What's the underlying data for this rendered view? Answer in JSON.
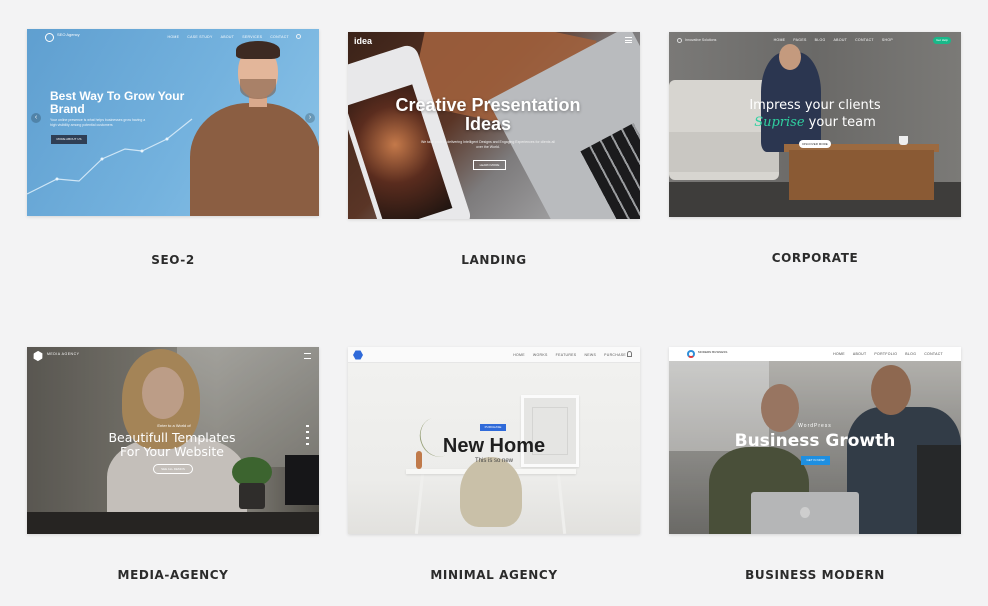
{
  "page_background": "#f3f3f4",
  "demos": [
    {
      "caption": "SEO-2",
      "thumb": {
        "logo_text": "SEO Agency",
        "nav": [
          "HOME",
          "CASE STUDY",
          "ABOUT",
          "SERVICES",
          "CONTACT"
        ],
        "hero": "Best Way To Grow Your Brand",
        "subtitle": "Your online presence is what helps businesses grow having a high visibility among potential customers",
        "button": "MORE ABOUT US",
        "accent": "#5f9fd0"
      }
    },
    {
      "caption": "LANDING",
      "thumb": {
        "brand": "idea",
        "hero": "Creative Presentation Ideas",
        "subtitle": "We take pride in delivering Intelligent Designs and Engaging Experiences for clients all over the World.",
        "button": "LEARN MORE"
      }
    },
    {
      "caption": "CORPORATE",
      "thumb": {
        "logo_text": "Innovative Solutions",
        "nav": [
          "HOME",
          "PAGES",
          "BLOG",
          "ABOUT",
          "CONTACT",
          "SHOP"
        ],
        "cta": "Get Help",
        "line1": "Impress your clients",
        "accent_word": "Suprise",
        "line2_rest": " your team",
        "button": "DISCOVER MORE",
        "accent": "#2fd1a0"
      }
    },
    {
      "caption": "MEDIA-AGENCY",
      "thumb": {
        "logo_text": "MEDIA AGENCY",
        "kicker": "Enter to a World of",
        "hero": "Beautifull Templates For Your Website",
        "button": "SEE ALL DEMOS"
      }
    },
    {
      "caption": "MINIMAL AGENCY",
      "thumb": {
        "nav": [
          "HOME",
          "WORKS",
          "FEATURES",
          "NEWS",
          "PURCHASE"
        ],
        "tag": "PURCHASE",
        "hero": "New Home",
        "subtitle": "This is so new",
        "accent": "#2f6ad9"
      }
    },
    {
      "caption": "BUSINESS MODERN",
      "thumb": {
        "logo_text": "MODERN BUSINESS",
        "nav": [
          "HOME",
          "ABOUT",
          "PORTFOLIO",
          "BLOG",
          "CONTACT"
        ],
        "kicker": "WordPress",
        "hero": "Business Growth",
        "button": "GET IN NOW",
        "accent": "#1e8fe1"
      }
    }
  ]
}
